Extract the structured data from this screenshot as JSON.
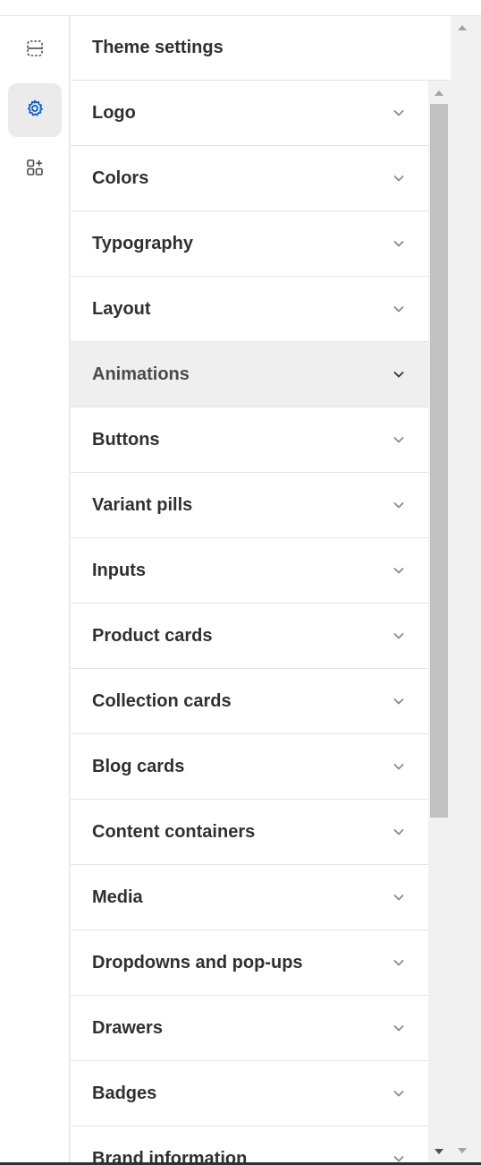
{
  "panel": {
    "title": "Theme settings"
  },
  "rail": {
    "items": [
      {
        "name": "sections",
        "icon": "sections-icon",
        "active": false
      },
      {
        "name": "theme-settings",
        "icon": "gear-icon",
        "active": true
      },
      {
        "name": "apps",
        "icon": "apps-icon",
        "active": false
      }
    ]
  },
  "settings": {
    "items": [
      {
        "label": "Logo"
      },
      {
        "label": "Colors"
      },
      {
        "label": "Typography"
      },
      {
        "label": "Layout"
      },
      {
        "label": "Animations",
        "hovered": true
      },
      {
        "label": "Buttons"
      },
      {
        "label": "Variant pills"
      },
      {
        "label": "Inputs"
      },
      {
        "label": "Product cards"
      },
      {
        "label": "Collection cards"
      },
      {
        "label": "Blog cards"
      },
      {
        "label": "Content containers"
      },
      {
        "label": "Media"
      },
      {
        "label": "Dropdowns and pop-ups"
      },
      {
        "label": "Drawers"
      },
      {
        "label": "Badges"
      },
      {
        "label": "Brand information"
      }
    ]
  },
  "colors": {
    "accent": "#005bd3",
    "text": "#303030",
    "hover_row": "#efefef",
    "border": "#e3e3e3"
  }
}
